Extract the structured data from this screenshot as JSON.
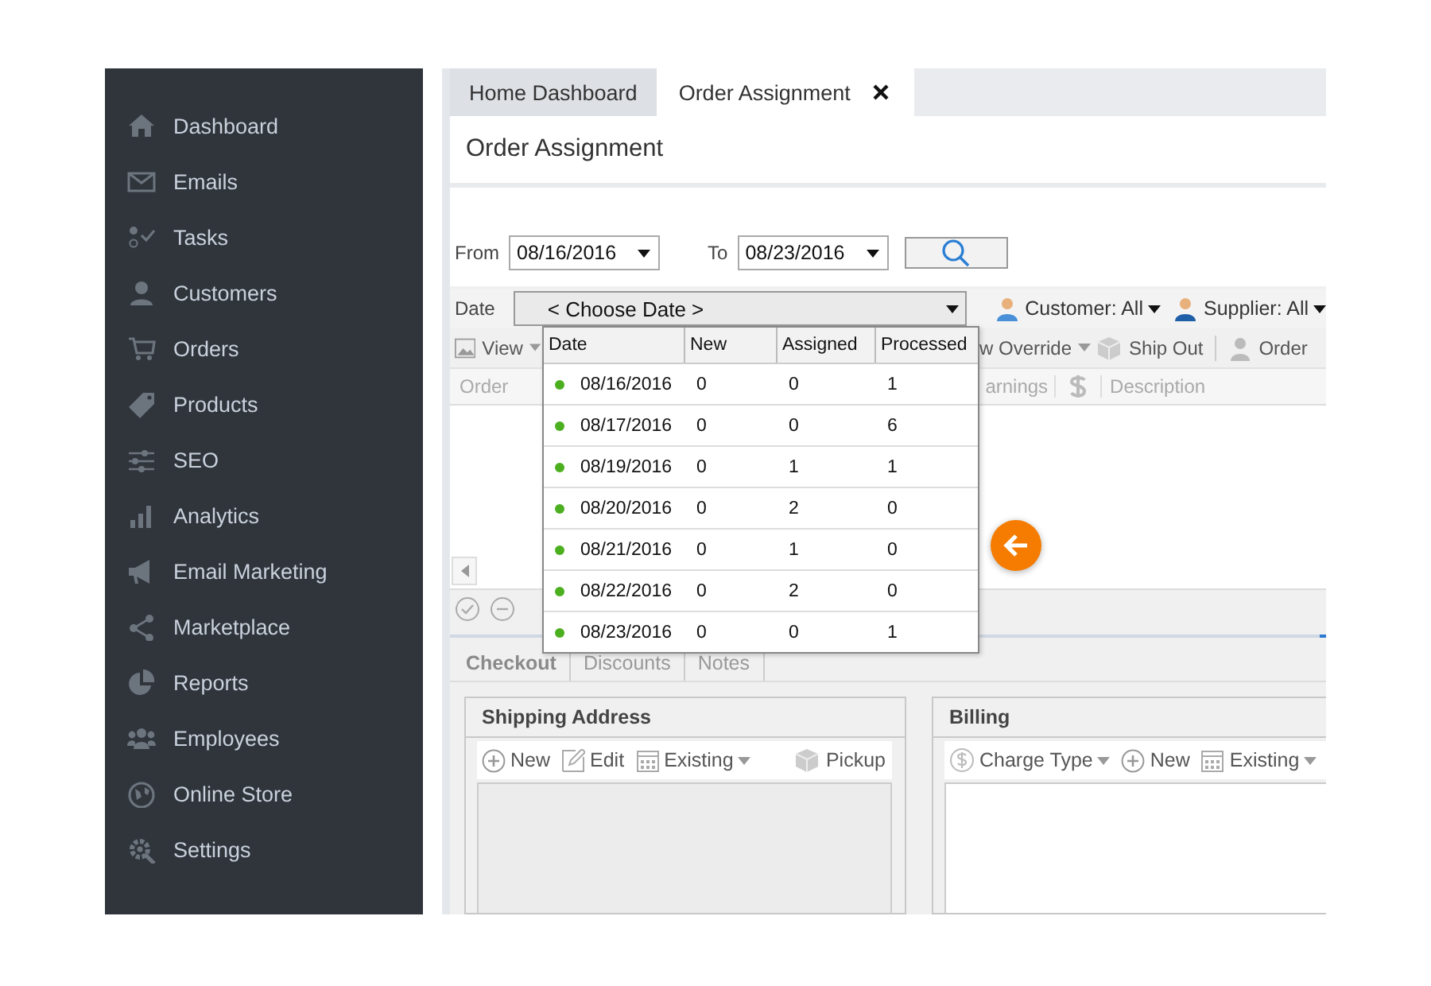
{
  "sidebar": {
    "items": [
      {
        "label": "Dashboard"
      },
      {
        "label": "Emails"
      },
      {
        "label": "Tasks"
      },
      {
        "label": "Customers"
      },
      {
        "label": "Orders"
      },
      {
        "label": "Products"
      },
      {
        "label": "SEO"
      },
      {
        "label": "Analytics"
      },
      {
        "label": "Email Marketing"
      },
      {
        "label": "Marketplace"
      },
      {
        "label": "Reports"
      },
      {
        "label": "Employees"
      },
      {
        "label": "Online Store"
      },
      {
        "label": "Settings"
      }
    ]
  },
  "tabs": [
    {
      "label": "Home Dashboard",
      "selected": false,
      "closable": false
    },
    {
      "label": "Order Assignment",
      "selected": true,
      "closable": true
    }
  ],
  "page_title": "Order Assignment",
  "filter": {
    "from_label": "From",
    "from_value": "08/16/2016",
    "to_label": "To",
    "to_value": "08/23/2016"
  },
  "date_filter": {
    "label": "Date",
    "value": "< Choose Date >",
    "customer": "Customer: All",
    "supplier": "Supplier: All"
  },
  "toolbar": {
    "view": "View",
    "override": "w Override",
    "ship_out": "Ship Out",
    "order": "Order"
  },
  "grid": {
    "columns": [
      "Order",
      "arnings",
      "Description"
    ]
  },
  "date_dropdown": {
    "columns": [
      "Date",
      "New",
      "Assigned",
      "Processed"
    ],
    "rows": [
      [
        "08/16/2016",
        "0",
        "0",
        "1"
      ],
      [
        "08/17/2016",
        "0",
        "0",
        "6"
      ],
      [
        "08/19/2016",
        "0",
        "1",
        "1"
      ],
      [
        "08/20/2016",
        "0",
        "2",
        "0"
      ],
      [
        "08/21/2016",
        "0",
        "1",
        "0"
      ],
      [
        "08/22/2016",
        "0",
        "2",
        "0"
      ],
      [
        "08/23/2016",
        "0",
        "0",
        "1"
      ]
    ]
  },
  "detail_tabs": [
    {
      "label": "Checkout",
      "selected": true
    },
    {
      "label": "Discounts",
      "selected": false
    },
    {
      "label": "Notes",
      "selected": false
    }
  ],
  "shipping": {
    "title": "Shipping Address",
    "actions": [
      "New",
      "Edit",
      "Existing",
      "Pickup"
    ]
  },
  "billing": {
    "title": "Billing",
    "actions": [
      "Charge Type",
      "New",
      "Existing"
    ]
  }
}
